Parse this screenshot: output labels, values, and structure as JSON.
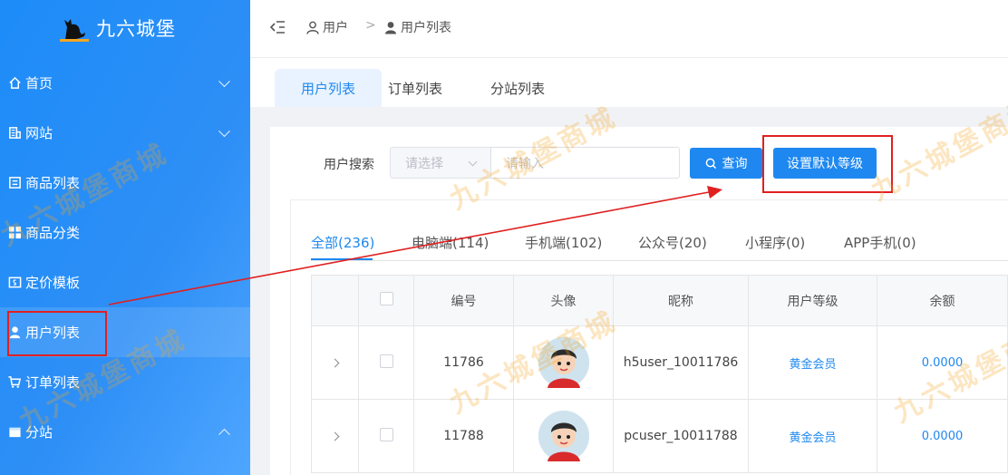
{
  "app": {
    "title": "九六城堡"
  },
  "sidebar": {
    "items": [
      {
        "label": "首页",
        "icon": "home-icon",
        "chevron": "down"
      },
      {
        "label": "网站",
        "icon": "building-icon",
        "chevron": "down"
      },
      {
        "label": "商品列表",
        "icon": "list-icon",
        "chevron": ""
      },
      {
        "label": "商品分类",
        "icon": "grid-icon",
        "chevron": ""
      },
      {
        "label": "定价模板",
        "icon": "price-tag-icon",
        "chevron": ""
      },
      {
        "label": "用户列表",
        "icon": "user-icon",
        "chevron": "",
        "active": true
      },
      {
        "label": "订单列表",
        "icon": "cart-icon",
        "chevron": ""
      },
      {
        "label": "分站",
        "icon": "store-icon",
        "chevron": "up"
      }
    ]
  },
  "breadcrumb": {
    "root": "用户",
    "separator": ">",
    "current": "用户列表"
  },
  "tabs": [
    {
      "label": "用户列表",
      "active": true
    },
    {
      "label": "订单列表",
      "active": false
    },
    {
      "label": "分站列表",
      "active": false
    }
  ],
  "search": {
    "label": "用户搜索",
    "select_placeholder": "请选择",
    "input_placeholder": "请输入",
    "query_button": "查询",
    "default_level_button": "设置默认等级"
  },
  "subtabs": [
    {
      "label": "全部(236)",
      "active": true
    },
    {
      "label": "电脑端(114)",
      "active": false
    },
    {
      "label": "手机端(102)",
      "active": false
    },
    {
      "label": "公众号(20)",
      "active": false
    },
    {
      "label": "小程序(0)",
      "active": false
    },
    {
      "label": "APP手机(0)",
      "active": false
    }
  ],
  "table": {
    "columns": [
      "",
      "",
      "编号",
      "头像",
      "昵称",
      "用户等级",
      "余额"
    ],
    "rows": [
      {
        "id": "11786",
        "nickname": "h5user_10011786",
        "level": "黄金会员",
        "balance": "0.0000"
      },
      {
        "id": "11788",
        "nickname": "pcuser_10011788",
        "level": "黄金会员",
        "balance": "0.0000"
      }
    ]
  },
  "watermark": "九六城堡商城",
  "colors": {
    "primary": "#1e88f0",
    "annotation": "#e02020",
    "watermark": "#f5a623"
  }
}
